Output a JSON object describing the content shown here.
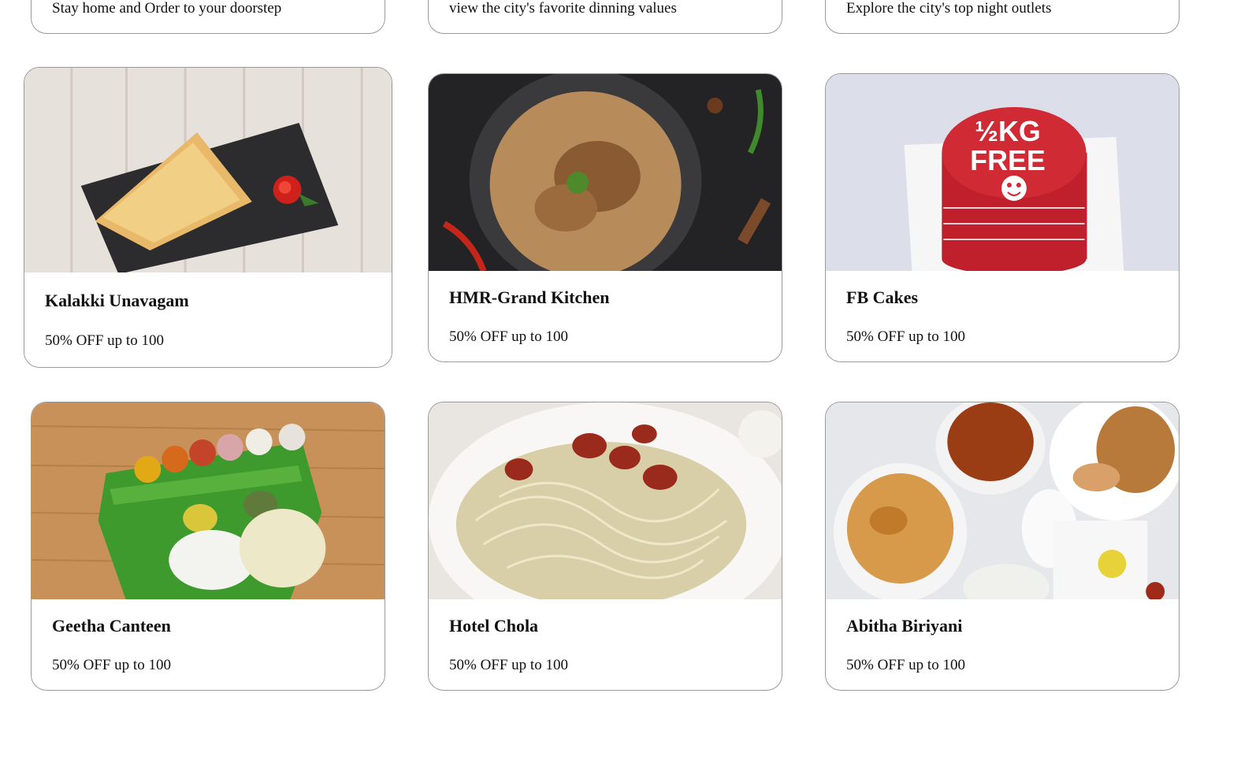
{
  "categories": [
    {
      "description": "Stay home and Order to your doorstep"
    },
    {
      "description": "view the city's favorite dinning values"
    },
    {
      "description": "Explore the city's top night outlets"
    }
  ],
  "restaurants": [
    {
      "name": "Kalakki Unavagam",
      "offer": "50% OFF up to 100",
      "image": "kalakki-dish-image"
    },
    {
      "name": "HMR-Grand Kitchen",
      "offer": "50% OFF up to 100",
      "image": "biryani-bowl-image"
    },
    {
      "name": "FB Cakes",
      "offer": "50% OFF up to 100",
      "image": "cake-image",
      "image_text": [
        "½KG",
        "FREE"
      ]
    },
    {
      "name": "Geetha Canteen",
      "offer": "50% OFF up to 100",
      "image": "banana-leaf-meal-image"
    },
    {
      "name": "Hotel Chola",
      "offer": "50% OFF up to 100",
      "image": "noodles-plate-image"
    },
    {
      "name": "Abitha Biriyani",
      "offer": "50% OFF up to 100",
      "image": "biriyani-bowls-image"
    }
  ]
}
